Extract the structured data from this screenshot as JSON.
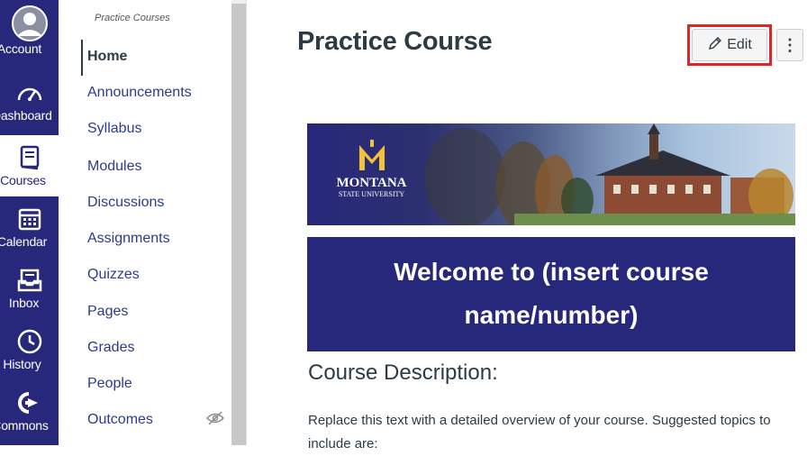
{
  "global_nav": {
    "items": [
      {
        "label": "Account",
        "icon": "account-avatar-icon"
      },
      {
        "label": "Dashboard",
        "icon": "dashboard-icon"
      },
      {
        "label": "Courses",
        "icon": "courses-icon"
      },
      {
        "label": "Calendar",
        "icon": "calendar-icon"
      },
      {
        "label": "Inbox",
        "icon": "inbox-icon"
      },
      {
        "label": "History",
        "icon": "history-icon"
      },
      {
        "label": "Commons",
        "icon": "commons-icon"
      }
    ]
  },
  "course_nav": {
    "breadcrumb": "Practice Courses",
    "items": [
      {
        "label": "Home"
      },
      {
        "label": "Announcements"
      },
      {
        "label": "Syllabus"
      },
      {
        "label": "Modules"
      },
      {
        "label": "Discussions"
      },
      {
        "label": "Assignments"
      },
      {
        "label": "Quizzes"
      },
      {
        "label": "Pages"
      },
      {
        "label": "Grades"
      },
      {
        "label": "People"
      },
      {
        "label": "Outcomes",
        "icon": "eye-slash-icon"
      }
    ]
  },
  "main": {
    "title": "Practice Course",
    "edit_label": "Edit",
    "more_label": "⋮",
    "banner": {
      "logo_line1": "MONTANA",
      "logo_line2": "STATE UNIVERSITY"
    },
    "welcome_line1": "Welcome to (insert course",
    "welcome_line2": "name/number)",
    "section_heading": "Course Description:",
    "body_text": "Replace this text with a detailed overview of your course. Suggested topics to include are:"
  },
  "colors": {
    "brand_navy": "#27287b",
    "link_blue": "#2d3b8c",
    "text": "#2d3b45",
    "highlight_red": "#e3232a"
  }
}
